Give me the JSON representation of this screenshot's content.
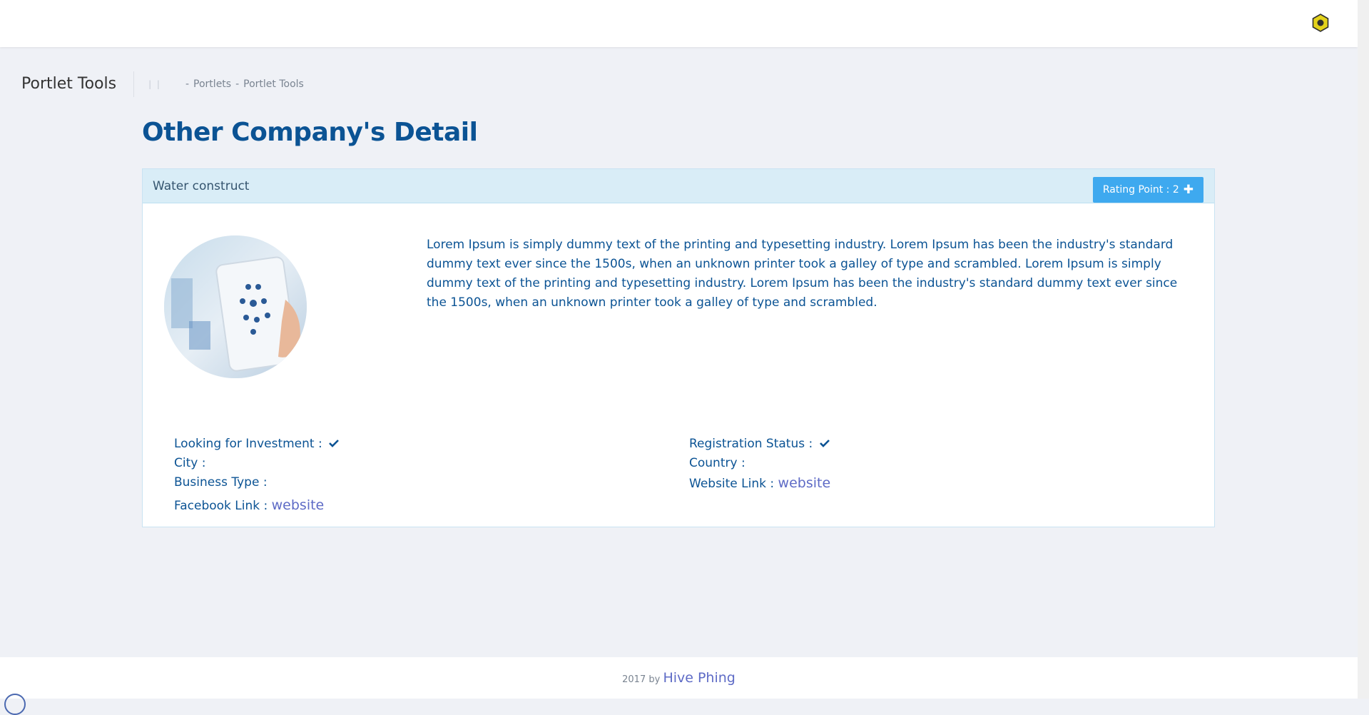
{
  "topbar": {
    "icon": "hexagon-settings-icon"
  },
  "page": {
    "title": "Portlet Tools",
    "breadcrumb": {
      "pipe": "| |",
      "sep1": "-",
      "item1": "Portlets",
      "sep2": "-",
      "item2": "Portlet Tools"
    }
  },
  "heading": "Other Company's Detail",
  "company": {
    "name": "Water construct",
    "rating_label": "Rating Point : 2",
    "rating_icon": "plus-icon",
    "description": "Lorem Ipsum is simply dummy text of the printing and typesetting industry. Lorem Ipsum has been the industry's standard dummy text ever since the 1500s, when an unknown printer took a galley of type and scrambled. Lorem Ipsum is simply dummy text of the printing and typesetting industry. Lorem Ipsum has been the industry's standard dummy text ever since the 1500s, when an unknown printer took a galley of type and scrambled.",
    "details": {
      "investment_label": "Looking for Investment :",
      "registration_label": "Registration Status :",
      "city_label": "City :",
      "country_label": "Country :",
      "business_label": "Business Type :",
      "website_label": "Website Link :",
      "website_text": "website",
      "facebook_label": "Facebook Link :",
      "facebook_text": "website"
    }
  },
  "footer": {
    "year": "2017 by",
    "brand": "Hive Phing"
  },
  "colors": {
    "primary": "#0b5394",
    "button": "#3ea9ef",
    "link": "#5e6bc6",
    "card_header": "#d9edf7"
  }
}
